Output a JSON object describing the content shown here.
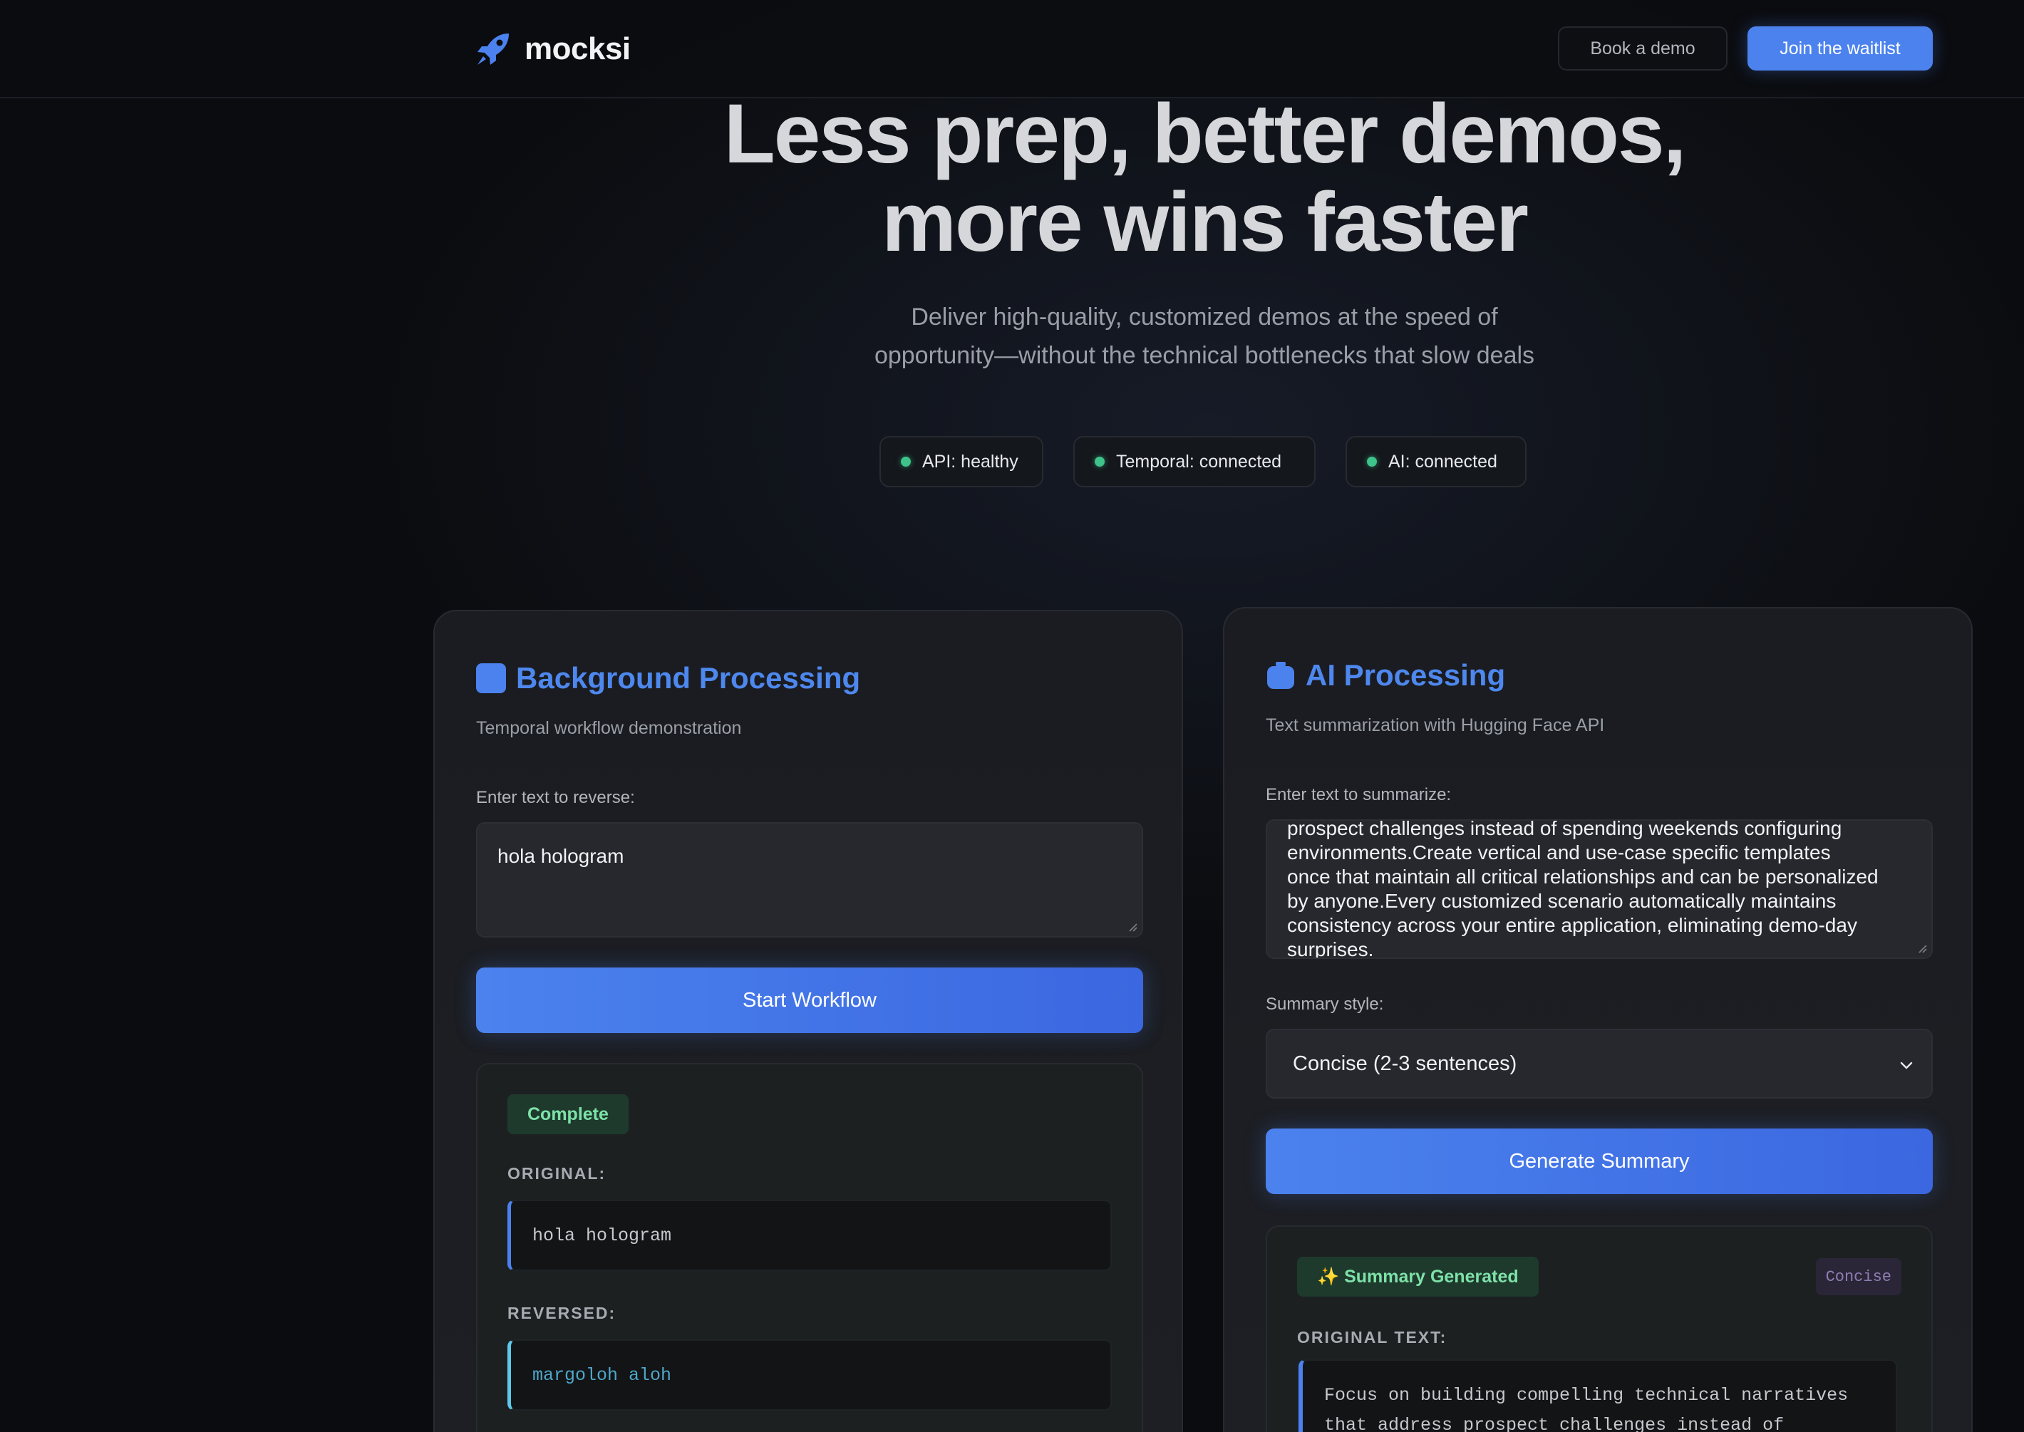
{
  "nav": {
    "brand": "mocksi",
    "book_demo": "Book a demo",
    "join_waitlist": "Join the waitlist"
  },
  "hero": {
    "title_line1": "Less prep, better demos,",
    "title_line2": "more wins faster",
    "subtitle_line1": "Deliver high-quality, customized demos at the speed of",
    "subtitle_line2": "opportunity—without the technical bottlenecks that slow deals"
  },
  "status": [
    {
      "label": "API: healthy",
      "color": "#3ec38a"
    },
    {
      "label": "Temporal: connected",
      "color": "#3ec38a"
    },
    {
      "label": "AI: connected",
      "color": "#3ec38a"
    }
  ],
  "background_card": {
    "icon": "blue-square-icon",
    "title": "Background Processing",
    "subtitle": "Temporal workflow demonstration",
    "input_label": "Enter text to reverse:",
    "input_value": "hola hologram",
    "button": "Start Workflow",
    "result": {
      "status": "Complete",
      "original_label": "ORIGINAL:",
      "original_value": "hola hologram",
      "reversed_label": "REVERSED:",
      "reversed_value": "margoloh aloh"
    }
  },
  "ai_card": {
    "icon": "robot-icon",
    "title": "AI Processing",
    "subtitle": "Text summarization with Hugging Face API",
    "input_label": "Enter text to summarize:",
    "input_lines": [
      "prospect challenges instead of spending weekends configuring",
      "environments.Create vertical and use-case specific templates",
      "once that maintain all critical relationships and can be personalized",
      "by anyone.Every customized scenario automatically maintains",
      "consistency across your entire application, eliminating demo-day",
      "surprises."
    ],
    "style_label": "Summary style:",
    "style_value": "Concise (2-3 sentences)",
    "button": "Generate Summary",
    "result": {
      "status": "✨ Summary Generated",
      "style_badge": "Concise",
      "original_label": "ORIGINAL TEXT:",
      "original_line1": "Focus on building compelling technical narratives",
      "original_line2": "that address prospect challenges instead of"
    }
  },
  "colors": {
    "accent": "#4b82ee",
    "status_green": "#3ec38a",
    "reversed_cyan": "#5dc8e8"
  }
}
